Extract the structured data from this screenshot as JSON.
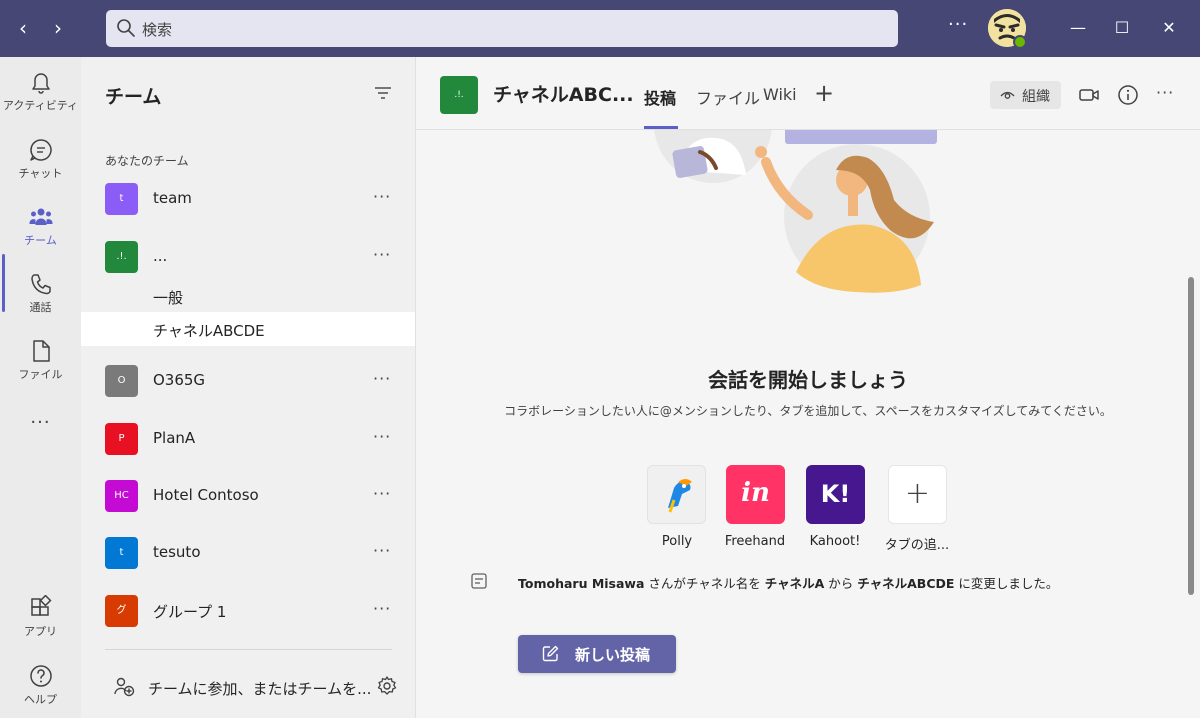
{
  "titlebar": {
    "search_placeholder": "検索",
    "more": "···",
    "back_arrow": "‹",
    "forward_arrow": "›",
    "minimize": "—",
    "maximize": "☐",
    "close": "✕"
  },
  "rail": {
    "items": [
      {
        "label": "アクティビティ",
        "icon": "bell-icon"
      },
      {
        "label": "チャット",
        "icon": "chat-icon"
      },
      {
        "label": "チーム",
        "icon": "teams-icon",
        "active": true
      },
      {
        "label": "通話",
        "icon": "phone-icon"
      },
      {
        "label": "ファイル",
        "icon": "file-icon"
      },
      {
        "label": "···",
        "icon": "more-icon"
      },
      {
        "label": "アプリ",
        "icon": "apps-icon"
      },
      {
        "label": "ヘルプ",
        "icon": "help-icon"
      }
    ]
  },
  "team_panel": {
    "title": "チーム",
    "section": "あなたのチーム",
    "teams": [
      {
        "tile": "t",
        "name": "team",
        "color": "#8b5cf6"
      },
      {
        "tile": ".!.",
        "name": "...",
        "color": "#21883c"
      },
      {
        "tile": "O",
        "name": "O365G",
        "color": "#7a7a7a"
      },
      {
        "tile": "P",
        "name": "PlanA",
        "color": "#e81123"
      },
      {
        "tile": "HC",
        "name": "Hotel Contoso",
        "color": "#c30bd4"
      },
      {
        "tile": "t",
        "name": "tesuto",
        "color": "#0078d4"
      },
      {
        "tile": "グ",
        "name": "グループ 1",
        "color": "#d83b01"
      }
    ],
    "channels": [
      {
        "name": "一般",
        "selected": false
      },
      {
        "name": "チャネルABCDE",
        "selected": true
      }
    ],
    "more": "···",
    "join": "チームに参加、またはチームを..."
  },
  "channel": {
    "tile": ".!.",
    "title": "チャネルABC...",
    "tabs": [
      "投稿",
      "ファイル",
      "Wiki"
    ],
    "add_tab": "+",
    "org_label": "組織",
    "more": "···"
  },
  "conversation": {
    "title": "会話を開始しましょう",
    "description": "コラボレーションしたい人に@メンションしたり、タブを追加して、スペースをカスタマイズしてみてください。",
    "apps": [
      {
        "label": "Polly",
        "icon": "polly-icon",
        "color": "#f0f0f0"
      },
      {
        "label": "Freehand",
        "icon": "invision-icon",
        "color": "#ff3366"
      },
      {
        "label": "Kahoot!",
        "icon": "kahoot-icon",
        "color": "#46178f"
      },
      {
        "label": "タブの追...",
        "icon": "plus-icon",
        "color": "#ffffff"
      }
    ],
    "kahoot_glyph": "K!",
    "freehand_glyph": "in",
    "plus_glyph": "+"
  },
  "system_message": {
    "user": "Tomoharu Misawa",
    "part1": " さんがチャネル名を ",
    "old_name": "チャネルA",
    "part2": " から ",
    "new_name": "チャネルABCDE",
    "part3": " に変更しました。"
  },
  "new_post": {
    "label": "新しい投稿"
  }
}
